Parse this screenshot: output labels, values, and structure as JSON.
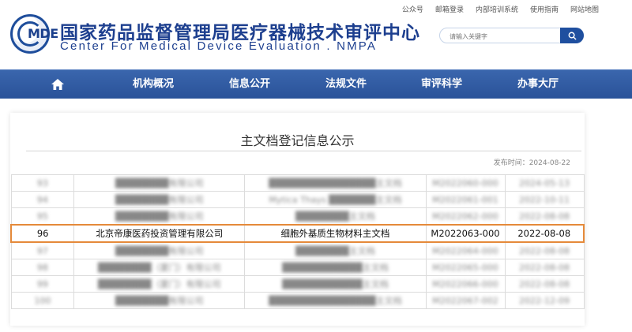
{
  "header": {
    "logo_text": "MDE",
    "title_cn": "国家药品监督管理局医疗器械技术审评中心",
    "title_en": "Center For Medical Device Evaluation . NMPA",
    "top_links": [
      "公众号",
      "邮箱登录",
      "内部培训系统",
      "使用指南",
      "网站地图"
    ],
    "search_placeholder": "请输入关键字"
  },
  "nav": {
    "items": [
      "机构概况",
      "信息公开",
      "法规文件",
      "审评科学",
      "办事大厅"
    ]
  },
  "page": {
    "title": "主文档登记信息公示",
    "publish_date": "发布时间：2024-08-22"
  },
  "table": {
    "rows": [
      {
        "no": "93",
        "company": "████████有限公司",
        "doc": "████████████████主文档",
        "code": "M2022060-000",
        "date": "2024-05-13",
        "blurred": true
      },
      {
        "no": "94",
        "company": "████████有限公司",
        "doc": "Mytica Thays ███████主文档",
        "code": "M2022061-001",
        "date": "2022-10-11",
        "blurred": true
      },
      {
        "no": "95",
        "company": "████████有限公司",
        "doc": "████████主文档",
        "code": "M2022062-000",
        "date": "2022-08-08",
        "blurred": true
      },
      {
        "no": "96",
        "company": "北京帝康医药投资管理有限公司",
        "doc": "细胞外基质生物材料主文档",
        "code": "M2022063-000",
        "date": "2022-08-08",
        "blurred": false
      },
      {
        "no": "97",
        "company": "████████有限公司",
        "doc": "████████主文档",
        "code": "M2022064-000",
        "date": "2022-08-08",
        "blurred": true
      },
      {
        "no": "98",
        "company": "████████（厦门）有限公司",
        "doc": "████████████主文档",
        "code": "M2022065-000",
        "date": "2022-08-08",
        "blurred": true
      },
      {
        "no": "99",
        "company": "████████（厦门）有限公司",
        "doc": "████████████主文档",
        "code": "M2022066-000",
        "date": "2022-08-08",
        "blurred": true
      },
      {
        "no": "100",
        "company": "████████有限公司",
        "doc": "████████████████主文档",
        "code": "M2022067-002",
        "date": "2022-12-09",
        "blurred": true
      }
    ]
  },
  "colors": {
    "brand_blue": "#1d3f8f",
    "nav_blue": "#2a5299",
    "highlight": "#e58a3a"
  }
}
